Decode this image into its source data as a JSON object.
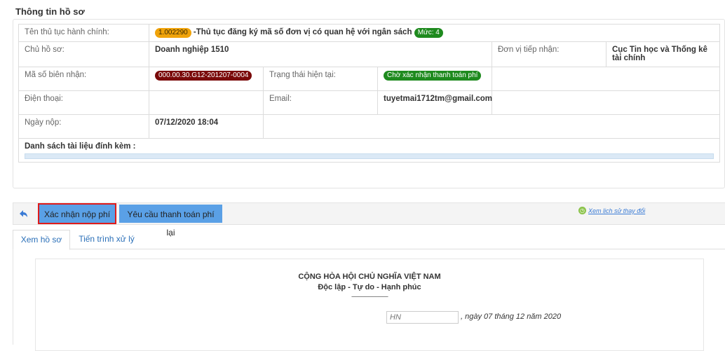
{
  "section_title": "Thông tin hồ sơ",
  "info": {
    "proc_label": "Tên thủ tục hành chính:",
    "proc_code": "1.002290",
    "proc_name": " -Thủ tục đăng ký mã số đơn vị có quan hệ với ngân sách ",
    "proc_level": "Mức: 4",
    "owner_label": "Chủ hồ sơ:",
    "owner_value": "Doanh nghiệp 1510",
    "receiver_label": "Đơn vị tiếp nhận:",
    "receiver_value": "Cục Tin học và Thống kê tài chính",
    "receipt_label": "Mã số biên nhận:",
    "receipt_value": "000.00.30.G12-201207-0004",
    "status_label": "Trạng thái hiện tại:",
    "status_value": "Chờ xác nhận thanh toán phí",
    "phone_label": "Điện thoại:",
    "phone_value": "",
    "email_label": "Email:",
    "email_value": "tuyetmai1712tm@gmail.com",
    "date_label": "Ngày nộp:",
    "date_value": "07/12/2020 18:04",
    "files_label": "Danh sách tài liệu đính kèm :"
  },
  "toolbar": {
    "confirm_label": "Xác nhận nộp phí",
    "request_label": "Yêu cầu thanh toán phí lại",
    "history_label": "Xem lịch sử thay đổi"
  },
  "tabs": [
    "Xem hồ sơ",
    "Tiến trình xử lý"
  ],
  "document": {
    "heading1": "CỘNG HÒA HỘI CHỦ NGHĨA VIỆT NAM",
    "heading2": "Độc lập - Tự do - Hạnh phúc",
    "dashes": "--------------------------",
    "place_placeholder": "HN",
    "date_text": ", ngày 07 tháng  12 năm 2020"
  }
}
